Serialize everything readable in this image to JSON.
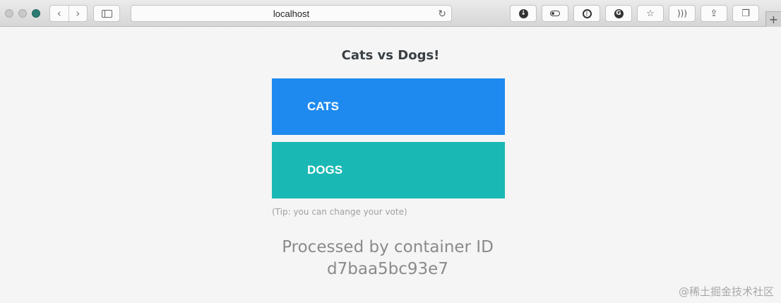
{
  "browser": {
    "address": "localhost",
    "icons": {
      "back": "chevron-left-icon",
      "forward": "chevron-right-icon",
      "sidebar": "sidebar-icon",
      "reload": "reload-icon",
      "download": "download-icon",
      "toggle": "toggle-icon",
      "password": "password-manager-icon",
      "grammarly": "grammarly-icon",
      "bookmark": "bookmark-icon",
      "rss": "rss-icon",
      "share": "share-icon",
      "tabs": "tabs-icon",
      "new_tab": "plus-icon"
    }
  },
  "page": {
    "title": "Cats vs Dogs!",
    "options": [
      {
        "label": "CATS",
        "color": "#1e8af0"
      },
      {
        "label": "DOGS",
        "color": "#1ab8b4"
      }
    ],
    "tip": "(Tip: you can change your vote)",
    "processed_label": "Processed by container ID",
    "container_id": "d7baa5bc93e7"
  },
  "watermark": "@稀土掘金技术社区"
}
